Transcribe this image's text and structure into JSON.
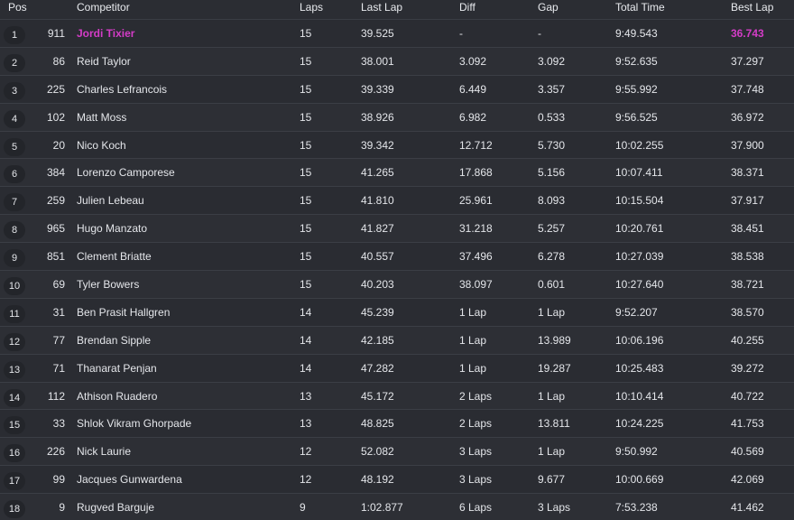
{
  "colors": {
    "background": "#2b2d33",
    "text": "#e4e6ea",
    "highlight": "#d43cc7"
  },
  "headers": {
    "pos": "Pos",
    "competitor": "Competitor",
    "laps": "Laps",
    "last_lap": "Last Lap",
    "diff": "Diff",
    "gap": "Gap",
    "total_time": "Total Time",
    "best_lap": "Best Lap"
  },
  "rows": [
    {
      "pos": "1",
      "num": "911",
      "name": "Jordi Tixier",
      "laps": "15",
      "last": "39.525",
      "diff": "-",
      "gap": "-",
      "total": "9:49.543",
      "best": "36.743",
      "leader": true
    },
    {
      "pos": "2",
      "num": "86",
      "name": "Reid Taylor",
      "laps": "15",
      "last": "38.001",
      "diff": "3.092",
      "gap": "3.092",
      "total": "9:52.635",
      "best": "37.297"
    },
    {
      "pos": "3",
      "num": "225",
      "name": "Charles Lefrancois",
      "laps": "15",
      "last": "39.339",
      "diff": "6.449",
      "gap": "3.357",
      "total": "9:55.992",
      "best": "37.748"
    },
    {
      "pos": "4",
      "num": "102",
      "name": "Matt Moss",
      "laps": "15",
      "last": "38.926",
      "diff": "6.982",
      "gap": "0.533",
      "total": "9:56.525",
      "best": "36.972"
    },
    {
      "pos": "5",
      "num": "20",
      "name": "Nico Koch",
      "laps": "15",
      "last": "39.342",
      "diff": "12.712",
      "gap": "5.730",
      "total": "10:02.255",
      "best": "37.900"
    },
    {
      "pos": "6",
      "num": "384",
      "name": "Lorenzo Camporese",
      "laps": "15",
      "last": "41.265",
      "diff": "17.868",
      "gap": "5.156",
      "total": "10:07.411",
      "best": "38.371"
    },
    {
      "pos": "7",
      "num": "259",
      "name": "Julien Lebeau",
      "laps": "15",
      "last": "41.810",
      "diff": "25.961",
      "gap": "8.093",
      "total": "10:15.504",
      "best": "37.917"
    },
    {
      "pos": "8",
      "num": "965",
      "name": "Hugo Manzato",
      "laps": "15",
      "last": "41.827",
      "diff": "31.218",
      "gap": "5.257",
      "total": "10:20.761",
      "best": "38.451"
    },
    {
      "pos": "9",
      "num": "851",
      "name": "Clement Briatte",
      "laps": "15",
      "last": "40.557",
      "diff": "37.496",
      "gap": "6.278",
      "total": "10:27.039",
      "best": "38.538"
    },
    {
      "pos": "10",
      "num": "69",
      "name": "Tyler Bowers",
      "laps": "15",
      "last": "40.203",
      "diff": "38.097",
      "gap": "0.601",
      "total": "10:27.640",
      "best": "38.721"
    },
    {
      "pos": "11",
      "num": "31",
      "name": "Ben Prasit Hallgren",
      "laps": "14",
      "last": "45.239",
      "diff": "1 Lap",
      "gap": "1 Lap",
      "total": "9:52.207",
      "best": "38.570"
    },
    {
      "pos": "12",
      "num": "77",
      "name": "Brendan Sipple",
      "laps": "14",
      "last": "42.185",
      "diff": "1 Lap",
      "gap": "13.989",
      "total": "10:06.196",
      "best": "40.255"
    },
    {
      "pos": "13",
      "num": "71",
      "name": "Thanarat Penjan",
      "laps": "14",
      "last": "47.282",
      "diff": "1 Lap",
      "gap": "19.287",
      "total": "10:25.483",
      "best": "39.272"
    },
    {
      "pos": "14",
      "num": "112",
      "name": "Athison Ruadero",
      "laps": "13",
      "last": "45.172",
      "diff": "2 Laps",
      "gap": "1 Lap",
      "total": "10:10.414",
      "best": "40.722"
    },
    {
      "pos": "15",
      "num": "33",
      "name": "Shlok Vikram Ghorpade",
      "laps": "13",
      "last": "48.825",
      "diff": "2 Laps",
      "gap": "13.811",
      "total": "10:24.225",
      "best": "41.753"
    },
    {
      "pos": "16",
      "num": "226",
      "name": "Nick Laurie",
      "laps": "12",
      "last": "52.082",
      "diff": "3 Laps",
      "gap": "1 Lap",
      "total": "9:50.992",
      "best": "40.569"
    },
    {
      "pos": "17",
      "num": "99",
      "name": "Jacques Gunwardena",
      "laps": "12",
      "last": "48.192",
      "diff": "3 Laps",
      "gap": "9.677",
      "total": "10:00.669",
      "best": "42.069"
    },
    {
      "pos": "18",
      "num": "9",
      "name": "Rugved Barguje",
      "laps": "9",
      "last": "1:02.877",
      "diff": "6 Laps",
      "gap": "3 Laps",
      "total": "7:53.238",
      "best": "41.462"
    }
  ]
}
